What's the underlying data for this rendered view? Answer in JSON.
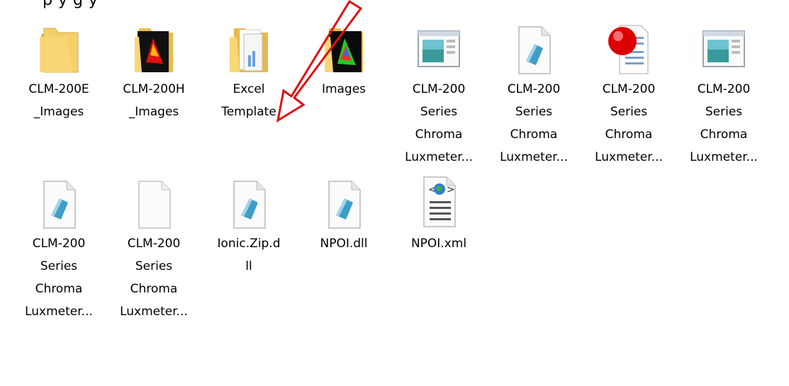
{
  "caption": "p   y  g     y",
  "files": [
    {
      "name": "CLM-200E\n_Images",
      "kind": "folder"
    },
    {
      "name": "CLM-200H\n_Images",
      "kind": "folder-dark"
    },
    {
      "name": "Excel\nTemplate",
      "kind": "folder-docs"
    },
    {
      "name": "Images",
      "kind": "folder-dark2"
    },
    {
      "name": "CLM-200\nSeries\nChroma\nLuxmeter...",
      "kind": "app"
    },
    {
      "name": "CLM-200\nSeries\nChroma\nLuxmeter...",
      "kind": "doc"
    },
    {
      "name": "CLM-200\nSeries\nChroma\nLuxmeter...",
      "kind": "redball"
    },
    {
      "name": "CLM-200\nSeries\nChroma\nLuxmeter...",
      "kind": "app"
    },
    {
      "name": "CLM-200\nSeries\nChroma\nLuxmeter...",
      "kind": "doc"
    },
    {
      "name": "CLM-200\nSeries\nChroma\nLuxmeter...",
      "kind": "blank"
    },
    {
      "name": "Ionic.Zip.d\nll",
      "kind": "doc"
    },
    {
      "name": "NPOI.dll",
      "kind": "doc"
    },
    {
      "name": "NPOI.xml",
      "kind": "xml"
    }
  ],
  "colors": {
    "arrow": "#e01010",
    "folder": "#f2c95a"
  }
}
